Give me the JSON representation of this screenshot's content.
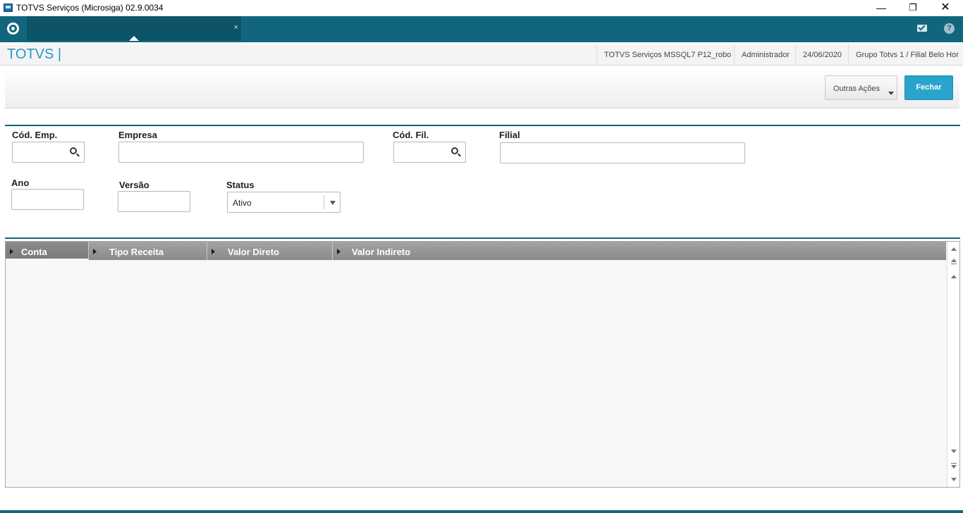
{
  "window": {
    "title": "TOTVS Serviços (Microsiga) 02.9.0034",
    "minimize": "—",
    "maximize": "❐",
    "close": "✕"
  },
  "appbar": {
    "tab_close": "×",
    "help": "?"
  },
  "header": {
    "brand": "TOTVS |",
    "environment": "TOTVS Serviços MSSQL7 P12_robo",
    "user": "Administrador",
    "date": "24/06/2020",
    "branch": "Grupo Totvs 1 / Filial Belo Hor"
  },
  "toolbar": {
    "outras_acoes": "Outras Ações",
    "fechar": "Fechar"
  },
  "form": {
    "cod_emp_label": "Cód. Emp.",
    "cod_emp_value": "",
    "empresa_label": "Empresa",
    "empresa_value": "",
    "cod_fil_label": "Cód. Fil.",
    "cod_fil_value": "",
    "filial_label": "Filial",
    "filial_value": "",
    "ano_label": "Ano",
    "ano_value": "",
    "versao_label": "Versão",
    "versao_value": "",
    "status_label": "Status",
    "status_value": "Ativo"
  },
  "grid": {
    "columns": [
      "Conta",
      "Tipo Receita",
      "Valor Direto",
      "Valor Indireto"
    ],
    "rows": []
  },
  "colors": {
    "teal": "#11667e",
    "accent_blue": "#2ba4cc",
    "brand_blue": "#2a98c2"
  }
}
